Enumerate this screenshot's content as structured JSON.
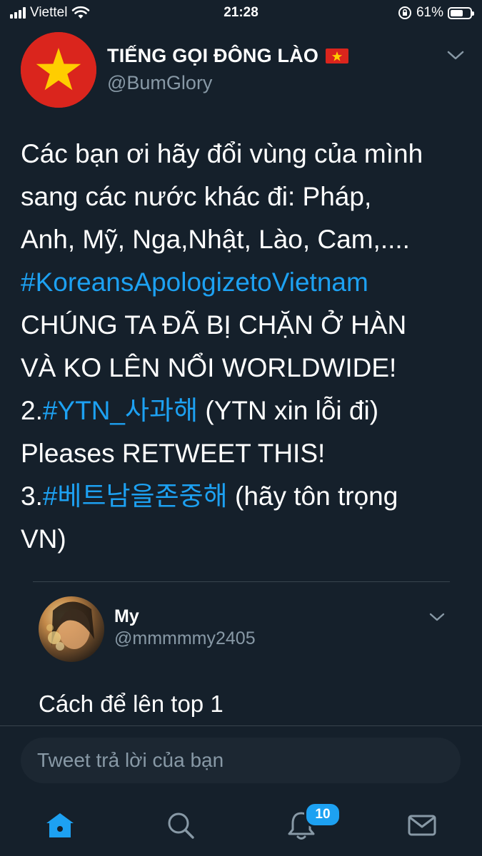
{
  "status_bar": {
    "carrier": "Viettel",
    "time": "21:28",
    "battery": "61%",
    "battery_level": 0.61
  },
  "tweet": {
    "author_name": "TIẾNG GỌI ĐÔNG LÀO",
    "author_handle": "@BumGlory",
    "avatar_icon": "vietnam-flag-icon",
    "lines": {
      "l1": "Các bạn ơi hãy đổi vùng của mình",
      "l2": "sang các nước khác đi: Pháp,",
      "l3": "Anh, Mỹ, Nga,Nhật, Lào, Cam,....",
      "l4_hashtag": "#KoreansApologizetoVietnam",
      "l5": "CHÚNG TA ĐÃ BỊ CHẶN Ở HÀN",
      "l6": "VÀ KO LÊN NỔI WORLDWIDE!",
      "l7_prefix": "2.",
      "l7_hashtag": "#YTN_사과해",
      "l7_suffix": " (YTN xin lỗi đi)",
      "l8": "Pleases RETWEET THIS!",
      "l9_prefix": "3.",
      "l9_hashtag": "#베트남을존중해",
      "l9_suffix": " (hãy tôn trọng",
      "l10": "VN)"
    }
  },
  "reply": {
    "author_name": "My",
    "author_handle": "@mmmmmy2405",
    "text": "Cách để lên top 1"
  },
  "composer": {
    "placeholder": "Tweet trả lời của bạn"
  },
  "tab_bar": {
    "notifications_badge": "10",
    "tabs": [
      "home-icon",
      "search-icon",
      "bell-icon",
      "mail-icon"
    ]
  },
  "colors": {
    "background": "#15202b",
    "accent": "#1da1f2",
    "secondary_text": "#8899a6",
    "divider": "#38444d",
    "flag_red": "#da251d",
    "flag_star": "#ffcd00"
  }
}
